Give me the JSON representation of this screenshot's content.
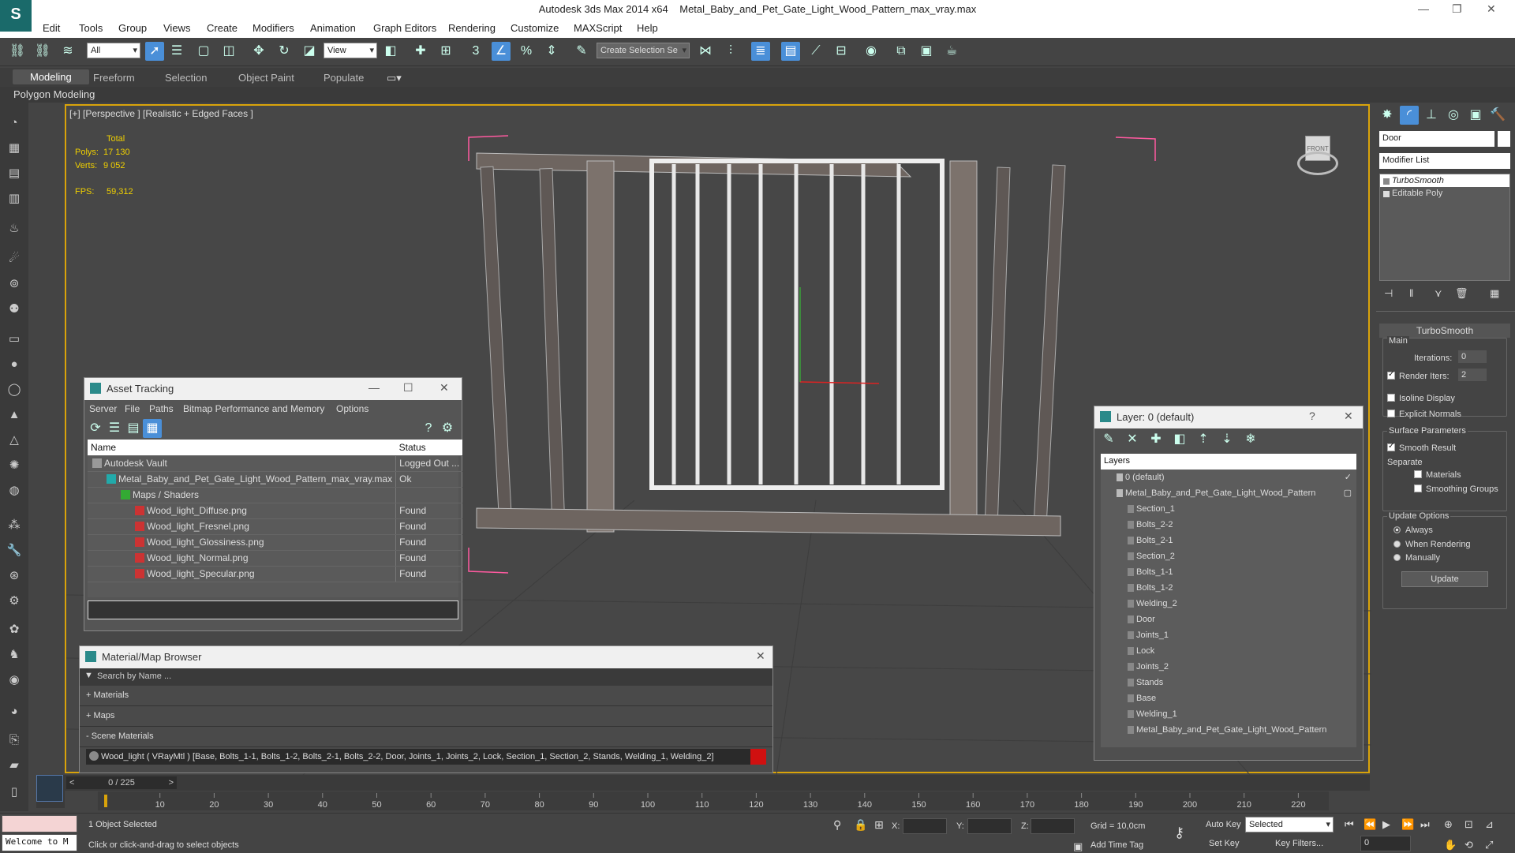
{
  "app": {
    "title_app": "Autodesk 3ds Max  2014 x64",
    "title_file": "Metal_Baby_and_Pet_Gate_Light_Wood_Pattern_max_vray.max"
  },
  "menu": [
    "Edit",
    "Tools",
    "Group",
    "Views",
    "Create",
    "Modifiers",
    "Animation",
    "Graph Editors",
    "Rendering",
    "Customize",
    "MAXScript",
    "Help"
  ],
  "toolbar": {
    "filter": "All",
    "refcoord": "View",
    "selection_set": "Create Selection Se"
  },
  "ribbon": {
    "tabs": [
      "Modeling",
      "Freeform",
      "Selection",
      "Object Paint",
      "Populate"
    ],
    "sub": "Polygon Modeling"
  },
  "viewport": {
    "label": "[+] [Perspective ] [Realistic + Edged Faces ]",
    "stats_total": "Total",
    "polys_label": "Polys:",
    "polys": "17 130",
    "verts_label": "Verts:",
    "verts": "9 052",
    "fps_label": "FPS:",
    "fps": "59,312",
    "cube_label": "FRONT"
  },
  "asset": {
    "title": "Asset Tracking",
    "menu": [
      "Server",
      "File",
      "Paths",
      "Bitmap Performance and Memory",
      "Options"
    ],
    "col_name": "Name",
    "col_status": "Status",
    "rows": [
      {
        "name": "Autodesk Vault",
        "status": "Logged Out ...",
        "indent": 0,
        "kind": "vault"
      },
      {
        "name": "Metal_Baby_and_Pet_Gate_Light_Wood_Pattern_max_vray.max",
        "status": "Ok",
        "indent": 1,
        "kind": "max"
      },
      {
        "name": "Maps / Shaders",
        "status": "",
        "indent": 2,
        "kind": "maps"
      },
      {
        "name": "Wood_light_Diffuse.png",
        "status": "Found",
        "indent": 3,
        "kind": "png"
      },
      {
        "name": "Wood_light_Fresnel.png",
        "status": "Found",
        "indent": 3,
        "kind": "png"
      },
      {
        "name": "Wood_light_Glossiness.png",
        "status": "Found",
        "indent": 3,
        "kind": "png"
      },
      {
        "name": "Wood_light_Normal.png",
        "status": "Found",
        "indent": 3,
        "kind": "png"
      },
      {
        "name": "Wood_light_Specular.png",
        "status": "Found",
        "indent": 3,
        "kind": "png"
      }
    ]
  },
  "matbrowser": {
    "title": "Material/Map Browser",
    "search": "Search by Name ...",
    "sections": [
      "+ Materials",
      "+ Maps",
      "- Scene Materials"
    ],
    "scene_material": "Wood_light  ( VRayMtl ) [Base, Bolts_1-1, Bolts_1-2, Bolts_2-1, Bolts_2-2, Door, Joints_1, Joints_2, Lock, Section_1, Section_2, Stands, Welding_1, Welding_2]"
  },
  "layer": {
    "title": "Layer: 0 (default)",
    "header": "Layers",
    "items": [
      "0 (default)",
      "Metal_Baby_and_Pet_Gate_Light_Wood_Pattern",
      "Section_1",
      "Bolts_2-2",
      "Bolts_2-1",
      "Section_2",
      "Bolts_1-1",
      "Bolts_1-2",
      "Welding_2",
      "Door",
      "Joints_1",
      "Lock",
      "Joints_2",
      "Stands",
      "Base",
      "Welding_1",
      "Metal_Baby_and_Pet_Gate_Light_Wood_Pattern"
    ]
  },
  "cmdpanel": {
    "object_name": "Door",
    "modifier_list": "Modifier List",
    "stack": [
      "TurboSmooth",
      "Editable Poly"
    ],
    "rollout": "TurboSmooth",
    "main": "Main",
    "iterations_label": "Iterations:",
    "iterations": "0",
    "render_iters_label": "Render Iters:",
    "render_iters": "2",
    "isoline": "Isoline Display",
    "explicit": "Explicit Normals",
    "surface": "Surface Parameters",
    "smooth": "Smooth Result",
    "separate": "Separate",
    "materials": "Materials",
    "smoothing": "Smoothing Groups",
    "update_opts": "Update Options",
    "always": "Always",
    "when_rendering": "When Rendering",
    "manually": "Manually",
    "update": "Update"
  },
  "timeline": {
    "frame": "0 / 225",
    "ticks": [
      "10",
      "20",
      "30",
      "40",
      "50",
      "60",
      "70",
      "80",
      "90",
      "100",
      "110",
      "120",
      "130",
      "140",
      "150",
      "160",
      "170",
      "180",
      "190",
      "200",
      "210",
      "220"
    ]
  },
  "status": {
    "maxscript": "Welcome to M",
    "selected": "1 Object Selected",
    "prompt": "Click or click-and-drag to select objects",
    "x": "X:",
    "y": "Y:",
    "z": "Z:",
    "grid": "Grid = 10,0cm",
    "autokey": "Auto Key",
    "setkey": "Set Key",
    "selected_dd": "Selected",
    "keyfilters": "Key Filters...",
    "addtimetag": "Add Time Tag",
    "frame_field": "0"
  },
  "colors": {
    "accent": "#d9a30a",
    "select_blue": "#4a8fd8",
    "brand": "#1a6a6a"
  }
}
